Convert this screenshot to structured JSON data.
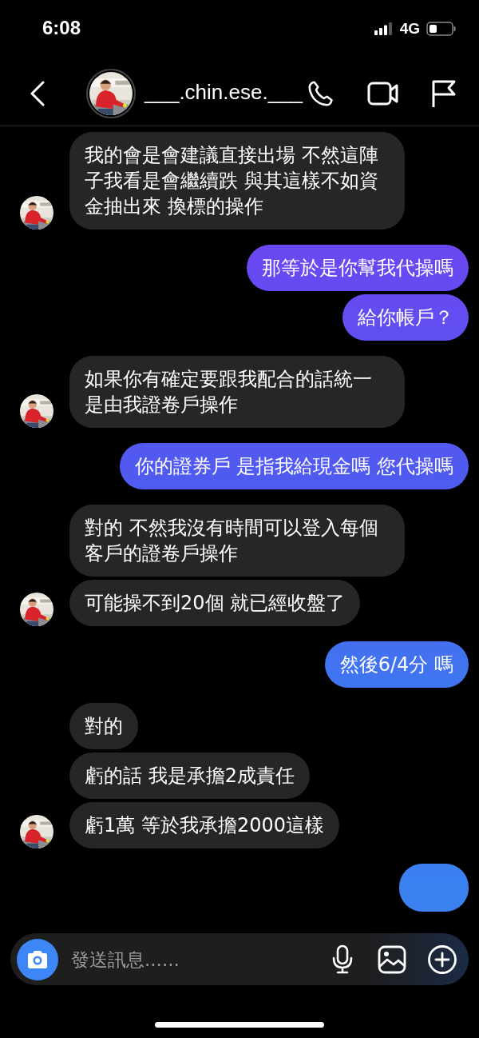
{
  "status_bar": {
    "time": "6:08",
    "network": "4G"
  },
  "header": {
    "username": "___.chin.ese.___"
  },
  "groups": [
    {
      "kind": "received",
      "messages": [
        "我的會是會建議直接出場 不然這陣子我看是會繼續跌 與其這樣不如資金抽出來 換標的操作"
      ]
    },
    {
      "kind": "sent",
      "messages": [
        "那等於是你幫我代操嗎",
        "給你帳戶？"
      ]
    },
    {
      "kind": "received",
      "messages": [
        "如果你有確定要跟我配合的話統一是由我證卷戶操作"
      ]
    },
    {
      "kind": "sent",
      "messages": [
        "你的證券戶 是指我給現金嗎 您代操嗎"
      ]
    },
    {
      "kind": "received",
      "messages": [
        "對的 不然我沒有時間可以登入每個客戶的證卷戶操作",
        "可能操不到20個 就已經收盤了"
      ]
    },
    {
      "kind": "sent",
      "messages": [
        "然後6/4分 嗎"
      ]
    },
    {
      "kind": "received",
      "messages": [
        "對的",
        "虧的話 我是承擔2成責任",
        "虧1萬 等於我承擔2000這樣"
      ]
    },
    {
      "kind": "sent",
      "cut_off": true
    }
  ],
  "composer": {
    "placeholder": "發送訊息......"
  }
}
